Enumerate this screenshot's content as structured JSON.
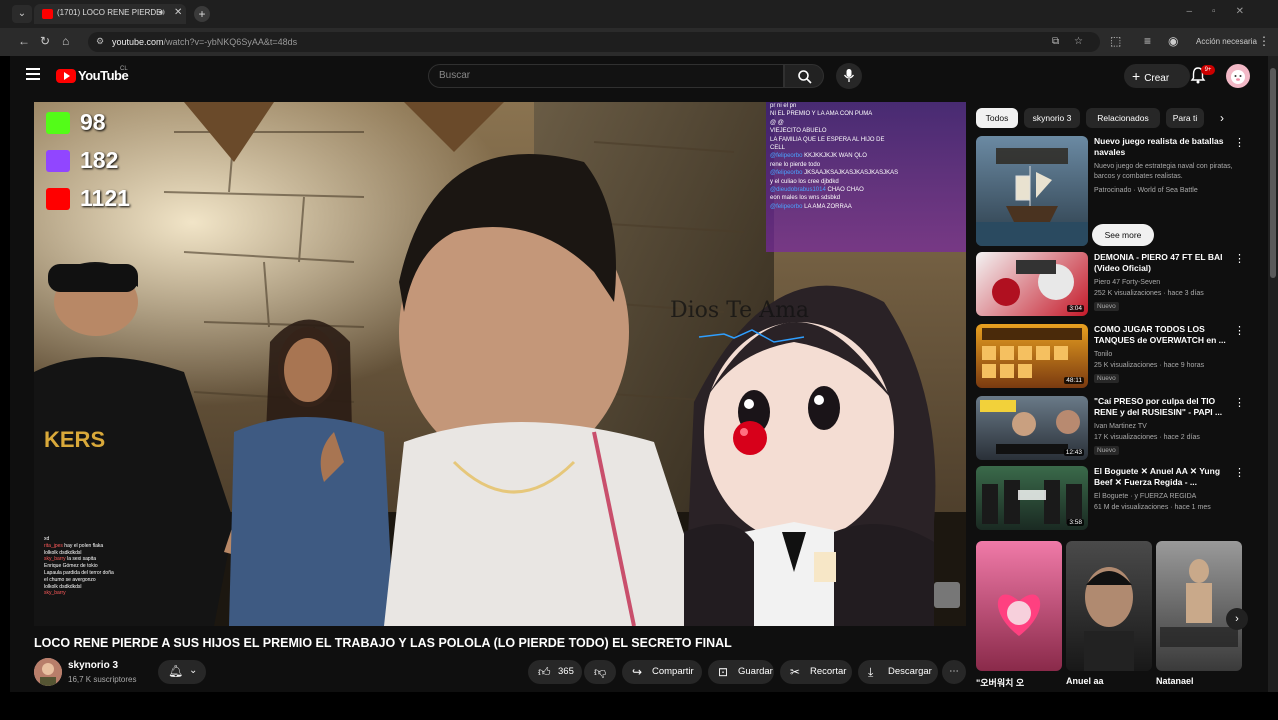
{
  "browser": {
    "tab_title": "(1701) LOCO RENE PIERDE",
    "url_host": "youtube.com",
    "url_path": "/watch?v=-ybNKQ6SyAA&t=48ds",
    "account_label": "Acción necesaria"
  },
  "masthead": {
    "logo_text": "YouTube",
    "logo_country": "CL",
    "search_placeholder": "Buscar",
    "create_label": "Crear",
    "notification_count": "9+"
  },
  "player": {
    "stats": [
      {
        "platform": "kick",
        "value": "98"
      },
      {
        "platform": "twitch",
        "value": "182"
      },
      {
        "platform": "youtube",
        "value": "1121"
      }
    ],
    "watermark": "Dios Te Ama",
    "chat_lines": [
      {
        "user": "",
        "text": "pr ni el pn"
      },
      {
        "user": "",
        "text": "NI EL PREMIO Y LA AMA CON PUMA"
      },
      {
        "user": "",
        "text": "@ @"
      },
      {
        "user": "",
        "text": "VIEJECITO ABUELO"
      },
      {
        "user": "",
        "text": "LA FAMILIA QUE LE ESPERA AL HIJO DE"
      },
      {
        "user": "",
        "text": "CELL"
      },
      {
        "user": "@felipeorbo",
        "text": "KKJKKJKJK WAN QLO"
      },
      {
        "user": "",
        "text": "rene lo pierde todo"
      },
      {
        "user": "@felipeorbo",
        "text": "JKSAAJKSAJKASJKASJKASJKAS"
      },
      {
        "user": "",
        "text": "y el culiao los cree djbdkd"
      },
      {
        "user": "@dieudobrabus1014",
        "text": "CHAO CHAO"
      },
      {
        "user": "",
        "text": "eon males los wns sdsbkd"
      },
      {
        "user": "@felipeorbo",
        "text": "LA AMA ZORRAA"
      }
    ],
    "mini_chat": [
      {
        "user": "",
        "text": "xd"
      },
      {
        "user": "rita_jpes",
        "text": "hay el polen flaka"
      },
      {
        "user": "",
        "text": "lolkolk dsdkdkdsl"
      },
      {
        "user": "sky_barry",
        "text": "la sexi sapita"
      },
      {
        "user": "",
        "text": "Enrique Gómez de tokio"
      },
      {
        "user": "",
        "text": "Lapaula pardida del terror doña"
      },
      {
        "user": "",
        "text": "el chumo se avergonzo"
      },
      {
        "user": "",
        "text": "lolkolk dsdkdkdsl"
      },
      {
        "user": "sky_barry",
        "text": ""
      }
    ]
  },
  "video": {
    "title": "LOCO RENE PIERDE A SUS HIJOS EL PREMIO EL TRABAJO Y LAS POLOLA (LO PIERDE TODO) EL SECRETO FINAL",
    "channel": "skynorio 3",
    "subscribers": "16,7 K suscriptores",
    "likes": "365",
    "share_label": "Compartir",
    "save_label": "Guardar",
    "clip_label": "Recortar",
    "download_label": "Descargar"
  },
  "chips": [
    "Todos",
    "skynorio 3",
    "Relacionados",
    "Para ti"
  ],
  "recommendations": [
    {
      "title": "Nuevo juego realista de batallas navales",
      "meta1": "Nuevo juego de estrategia naval con piratas, barcos y combates realistas.",
      "meta2": "Patrocinado · World of Sea Battle",
      "badge": "",
      "duration": "",
      "cta": "See more"
    },
    {
      "title": "DEMONIA - PIERO 47 FT EL BAI (Video Oficial)",
      "meta1": "Piero 47 Forty-Seven",
      "meta2": "252 K visualizaciones · hace 3 días",
      "badge": "Nuevo",
      "duration": "3:04",
      "cta": ""
    },
    {
      "title": "COMO JUGAR TODOS LOS TANQUES de OVERWATCH en ...",
      "meta1": "Tonilo",
      "meta2": "25 K visualizaciones · hace 9 horas",
      "badge": "Nuevo",
      "duration": "48:11",
      "cta": ""
    },
    {
      "title": "\"Caí PRESO por culpa del TIO RENE y del RUSIESIN\" - PAPI ...",
      "meta1": "Ivan Martinez TV",
      "meta2": "17 K visualizaciones · hace 2 días",
      "badge": "Nuevo",
      "duration": "12:43",
      "cta": ""
    },
    {
      "title": "El Boguete ✕ Anuel AA ✕ Yung Beef ✕ Fuerza Regida - ...",
      "meta1": "El Boguete · y FUERZA REGIDA",
      "meta2": "61 M de visualizaciones · hace 1 mes",
      "badge": "",
      "duration": "3:58",
      "cta": ""
    }
  ],
  "shorts": [
    {
      "caption": "\"오버워치 오"
    },
    {
      "caption": "Anuel aa"
    },
    {
      "caption": "Natanael"
    }
  ]
}
